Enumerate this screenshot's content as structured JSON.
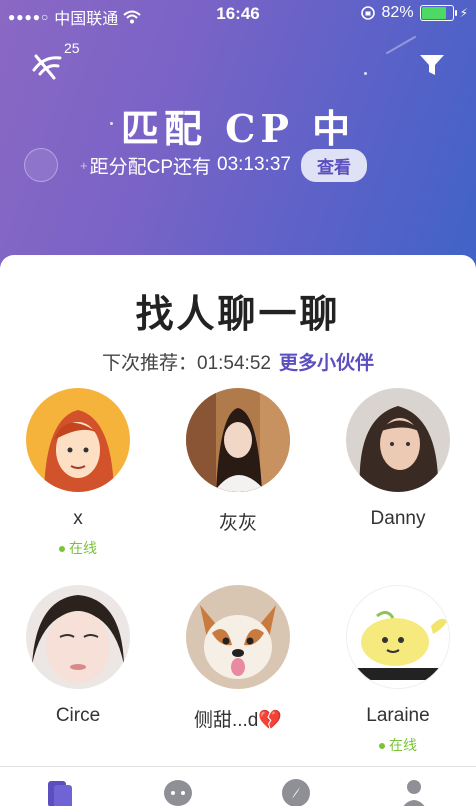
{
  "status_bar": {
    "carrier": "中国联通",
    "time": "16:46",
    "battery_percent": "82%",
    "battery_level": 0.82
  },
  "header": {
    "signal_count": "25",
    "title": "匹配 CP 中",
    "countdown_label": "距分配CP还有",
    "countdown_time": "03:13:37",
    "view_button": "查看"
  },
  "card": {
    "title": "找人聊一聊",
    "next_label": "下次推荐：",
    "next_time": "01:54:52",
    "more_link": "更多小伙伴"
  },
  "online_label": "在线",
  "users": [
    {
      "name": "x",
      "online": true,
      "avatar": "cartoon-girl-avatar"
    },
    {
      "name": "灰灰",
      "online": false,
      "avatar": "photo-girl-avatar"
    },
    {
      "name": "Danny",
      "online": false,
      "avatar": "photo-woman-avatar"
    },
    {
      "name": "Circe",
      "online": false,
      "avatar": "photo-face-avatar"
    },
    {
      "name": "侧甜...d💔",
      "online": false,
      "avatar": "dog-avatar"
    },
    {
      "name": "Laraine",
      "online": true,
      "avatar": "cartoon-whale-avatar"
    }
  ],
  "tabs": [
    {
      "icon": "cards-icon",
      "active": true
    },
    {
      "icon": "chat-icon",
      "active": false
    },
    {
      "icon": "compass-icon",
      "active": false
    },
    {
      "icon": "profile-icon",
      "active": false
    }
  ],
  "colors": {
    "accent": "#5b4fbf",
    "online": "#7cc33a",
    "tab_active": "#5b4fbf",
    "tab_inactive": "#8f8f96"
  }
}
